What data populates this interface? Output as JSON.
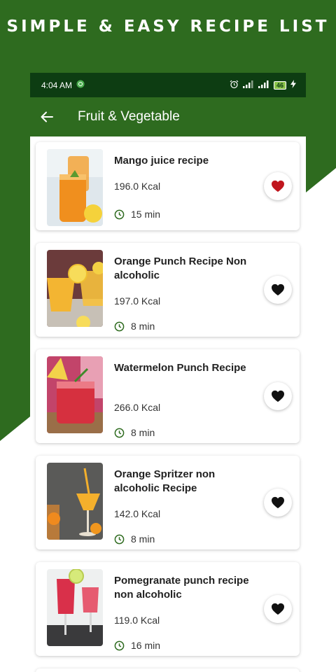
{
  "promo": {
    "title": "SIMPLE & EASY RECIPE LIST"
  },
  "status_bar": {
    "time": "4:04 AM",
    "battery": "46"
  },
  "app_bar": {
    "title": "Fruit & Vegetable"
  },
  "colors": {
    "brand_green": "#2e6b1f",
    "status_green": "#0d3d12",
    "fav_active": "#c0161e",
    "fav_inactive": "#111111",
    "clock_icon": "#2e6b1f"
  },
  "recipes": [
    {
      "name": "Mango juice recipe",
      "kcal": "196.0 Kcal",
      "time": "15 min",
      "favorite": true
    },
    {
      "name": "Orange Punch Recipe Non alcoholic",
      "kcal": "197.0 Kcal",
      "time": "8 min",
      "favorite": false
    },
    {
      "name": "Watermelon Punch Recipe",
      "kcal": "266.0 Kcal",
      "time": "8 min",
      "favorite": false
    },
    {
      "name": "Orange Spritzer non alcoholic Recipe",
      "kcal": "142.0 Kcal",
      "time": "8 min",
      "favorite": false
    },
    {
      "name": "Pomegranate punch recipe non alcoholic",
      "kcal": "119.0 Kcal",
      "time": "16 min",
      "favorite": false
    }
  ]
}
